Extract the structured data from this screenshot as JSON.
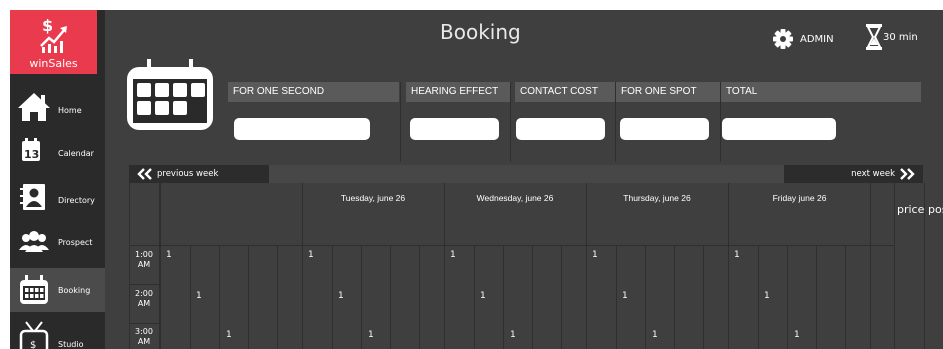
{
  "app": {
    "logo_text": "winSales",
    "title": "Booking",
    "user_label": "ADMIN",
    "timer_label": "30 min",
    "colors": {
      "brand": "#ea3b4e",
      "background": "#3f3f3f",
      "sidebar": "#2a2a2a"
    }
  },
  "sidebar": {
    "items": [
      {
        "label": "Home",
        "icon": "home-icon"
      },
      {
        "label": "Calendar",
        "icon": "calendar-icon"
      },
      {
        "label": "Directory",
        "icon": "directory-icon"
      },
      {
        "label": "Prospect",
        "icon": "prospect-icon"
      },
      {
        "label": "Booking",
        "icon": "booking-icon",
        "active": true
      },
      {
        "label": "Studio",
        "icon": "studio-icon"
      }
    ]
  },
  "summary": {
    "columns": [
      {
        "label": "FOR ONE SECOND",
        "value": ""
      },
      {
        "label": "HEARING EFFECT",
        "value": ""
      },
      {
        "label": "CONTACT COST",
        "value": ""
      },
      {
        "label": "FOR ONE SPOT",
        "value": ""
      },
      {
        "label": "TOTAL",
        "value": ""
      }
    ]
  },
  "week_nav": {
    "previous_label": "previous week",
    "next_label": "next week"
  },
  "schedule": {
    "days": [
      {
        "label": ""
      },
      {
        "label": "Tuesday, june 26"
      },
      {
        "label": "Wednesday, june 26"
      },
      {
        "label": "Thursday, june 26"
      },
      {
        "label": "Friday june 26"
      }
    ],
    "times": [
      "1:00 AM",
      "2:00 AM",
      "3:00 AM"
    ],
    "slot_value": "1",
    "extra_columns": [
      "price",
      "post"
    ]
  }
}
